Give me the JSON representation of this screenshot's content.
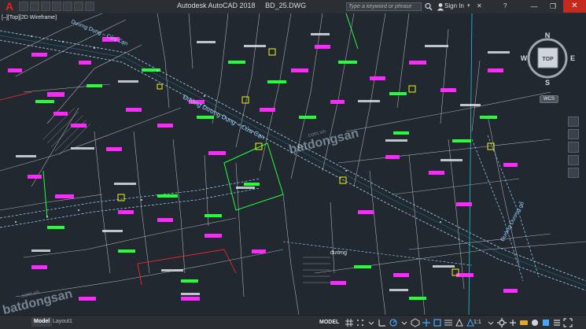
{
  "titlebar": {
    "app_title": "Autodesk AutoCAD 2018",
    "file_name": "BD_25.DWG",
    "search_placeholder": "Type a keyword or phrase",
    "sign_in": "Sign In",
    "close_glyph": "✕",
    "minimize_glyph": "—",
    "maximize_glyph": "❐",
    "help_glyph": "?",
    "x_glyph": "✕",
    "caret_glyph": "▾"
  },
  "viewport": {
    "label": "[–][Top][2D Wireframe]"
  },
  "viewcube": {
    "north": "N",
    "south": "S",
    "east": "E",
    "west": "W",
    "face": "TOP",
    "wcs": "WCS"
  },
  "drawing": {
    "road_main": "Đường Dương Dụng – Cửa Cạn",
    "road_main_short": "Dương Dụng – Cửa Cạn",
    "road_right": "Đường Dương gỗ",
    "road_bottom": "đường",
    "colors": {
      "background": "#212830",
      "parcel_lines": "#d8dcdf",
      "road": "#9fd4ff",
      "magenta": "#ff2aff",
      "green": "#25ff3a",
      "yellow": "#f4f21a",
      "red": "#ff2b2b",
      "cyan": "#18c9d8"
    }
  },
  "watermark": {
    "small": ".com.vn",
    "big": "batdongsan"
  },
  "tabs": {
    "model": "Model",
    "layout1": "Layout1"
  },
  "statusbar": {
    "model": "MODEL",
    "scale": "1:1"
  }
}
